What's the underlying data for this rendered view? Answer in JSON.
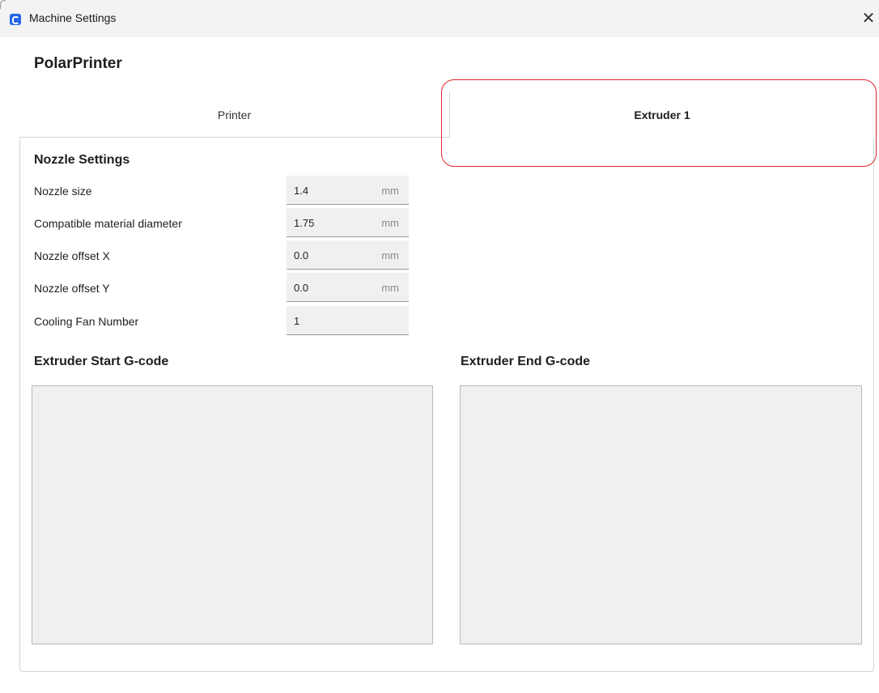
{
  "window": {
    "title": "Machine Settings",
    "close_glyph": "✕"
  },
  "machine_name": "PolarPrinter",
  "tabs": [
    {
      "label": "Printer",
      "active": false
    },
    {
      "label": "Extruder 1",
      "active": true
    }
  ],
  "nozzle_settings": {
    "title": "Nozzle Settings",
    "rows": [
      {
        "label": "Nozzle size",
        "value": "1.4",
        "unit": "mm"
      },
      {
        "label": "Compatible material diameter",
        "value": "1.75",
        "unit": "mm"
      },
      {
        "label": "Nozzle offset X",
        "value": "0.0",
        "unit": "mm"
      },
      {
        "label": "Nozzle offset Y",
        "value": "0.0",
        "unit": "mm"
      },
      {
        "label": "Cooling Fan Number",
        "value": "1",
        "unit": ""
      }
    ]
  },
  "gcode": {
    "start_title": "Extruder Start G-code",
    "start_value": "",
    "end_title": "Extruder End G-code",
    "end_value": ""
  },
  "colors": {
    "accent_blue": "#2366e8",
    "highlight_red": "#e0262a",
    "field_bg": "#f0f0f0"
  },
  "icons": {
    "app": "cura-app-icon",
    "close": "close-icon"
  }
}
